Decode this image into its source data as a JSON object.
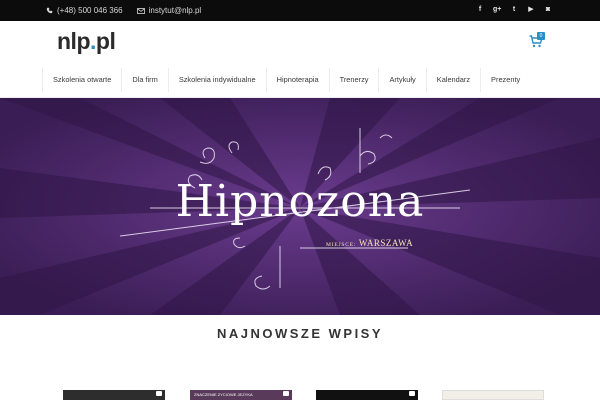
{
  "topbar": {
    "phone": "(+48) 500 046 366",
    "email": "instytut@nlp.pl",
    "social_icons": [
      "facebook-icon",
      "google-plus-icon",
      "twitter-icon",
      "youtube-icon",
      "instagram-icon"
    ],
    "social_glyphs": [
      "f",
      "g+",
      "t",
      "▶",
      "◙"
    ]
  },
  "header": {
    "logo_main": "nlp",
    "logo_dot": ".",
    "logo_tld": "pl",
    "cart_count": "0"
  },
  "nav": {
    "items": [
      "Szkolenia otwarte",
      "Dla firm",
      "Szkolenia indywidualne",
      "Hipnoterapia",
      "Trenerzy",
      "Artykuły",
      "Kalendarz",
      "Prezenty"
    ]
  },
  "banner": {
    "title": "Hipnozona",
    "place_label": "MIEJSCE:",
    "place_value": "WARSZAWA"
  },
  "latest": {
    "title": "NAJNOWSZE WPISY",
    "thumb_caption": "ZNACZENIE ZYCIOWE JEZYKA"
  },
  "colors": {
    "accent": "#2a8fc3",
    "topbar_bg": "#0c0c0c",
    "banner_purple": "#4a2768",
    "banner_text_gold": "#f5e6b8"
  }
}
